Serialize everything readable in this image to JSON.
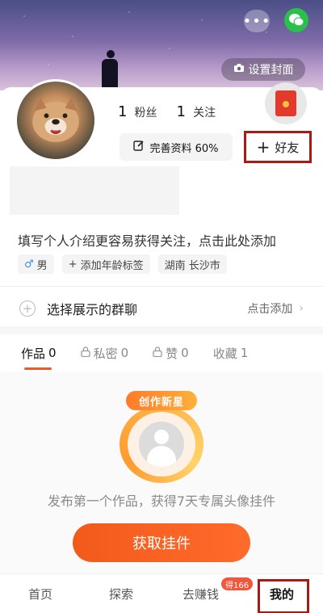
{
  "cover": {
    "set_cover_label": "设置封面",
    "more_icon": "more-dots-icon",
    "wechat_icon": "wechat-icon",
    "camera_icon": "camera-icon"
  },
  "profile": {
    "followers_count": "1",
    "followers_label": "粉丝",
    "following_count": "1",
    "following_label": "关注",
    "complete_profile_label": "完善资料 60%",
    "add_friend_label": "好友",
    "bio_prompt": "填写个人介绍更容易获得关注，点击此处添加",
    "tags": {
      "gender": "男",
      "add_age": "添加年龄标签",
      "location": "湖南 长沙市"
    }
  },
  "group_chat": {
    "label": "选择展示的群聊",
    "action": "点击添加"
  },
  "tabs": [
    {
      "label": "作品",
      "count": "0"
    },
    {
      "label": "私密",
      "count": "0"
    },
    {
      "label": "赞",
      "count": "0"
    },
    {
      "label": "收藏",
      "count": "1"
    }
  ],
  "promo": {
    "badge_text": "创作新星",
    "text": "发布第一个作品，获得7天专属头像挂件",
    "button": "获取挂件"
  },
  "bottom_nav": {
    "home": "首页",
    "explore": "探索",
    "earn": "去赚钱",
    "earn_badge": "得166",
    "mine": "我的"
  },
  "colors": {
    "accent": "#f15a24",
    "highlight_box": "#a71b15",
    "wechat": "#2bbf4b"
  }
}
